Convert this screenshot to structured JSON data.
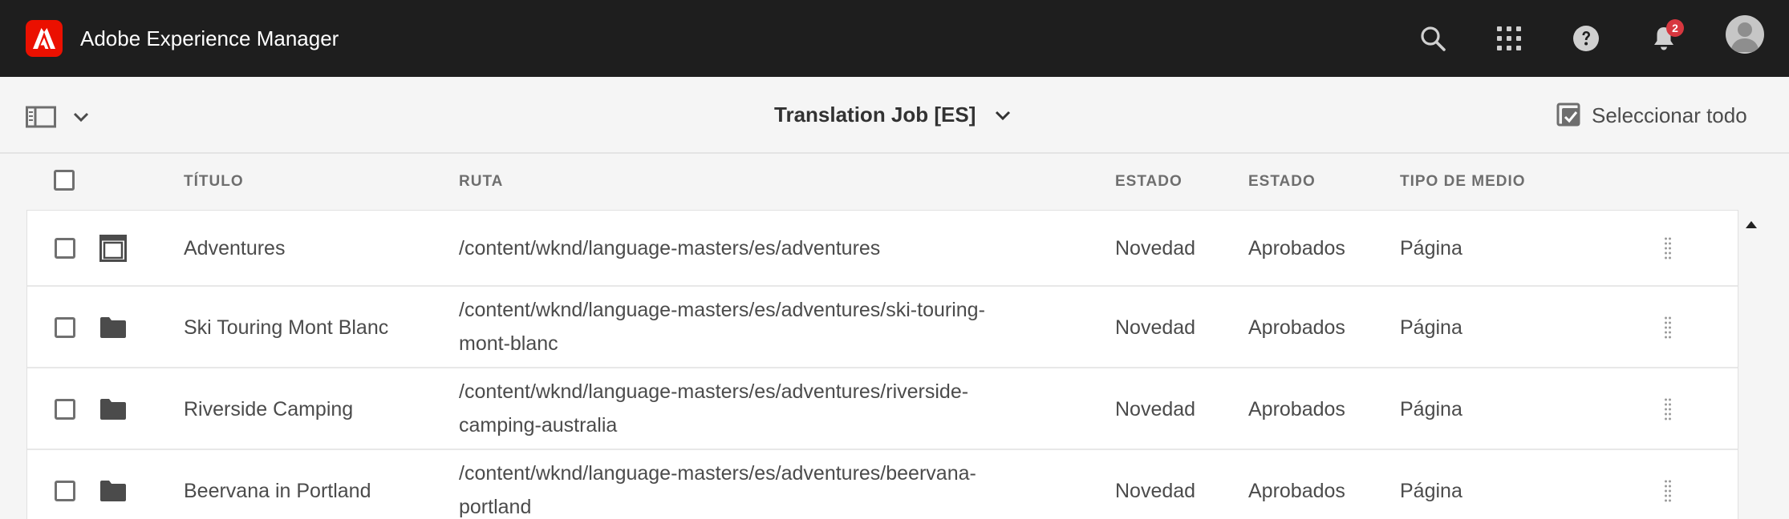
{
  "shell": {
    "app_name": "Adobe Experience Manager",
    "notification_count": "2",
    "icons": [
      "search-icon",
      "apps-grid-icon",
      "help-icon",
      "bell-icon",
      "avatar"
    ]
  },
  "actionbar": {
    "job_title": "Translation Job [ES]",
    "select_all_label": "Seleccionar todo"
  },
  "columns": {
    "title": "TÍTULO",
    "path": "RUTA",
    "status1": "ESTADO",
    "status2": "ESTADO",
    "media_type": "TIPO DE MEDIO"
  },
  "rows": [
    {
      "icon": "page-icon",
      "title": "Adventures",
      "path_line1": "/content/wknd/language-masters/es/adventures",
      "path_line2": "",
      "status1": "Novedad",
      "status2": "Aprobados",
      "media_type": "Página"
    },
    {
      "icon": "folder-icon",
      "title": "Ski Touring Mont Blanc",
      "path_line1": "/content/wknd/language-masters/es/adventures/ski-touring-",
      "path_line2": "mont-blanc",
      "status1": "Novedad",
      "status2": "Aprobados",
      "media_type": "Página"
    },
    {
      "icon": "folder-icon",
      "title": "Riverside Camping",
      "path_line1": "/content/wknd/language-masters/es/adventures/riverside-",
      "path_line2": "camping-australia",
      "status1": "Novedad",
      "status2": "Aprobados",
      "media_type": "Página"
    },
    {
      "icon": "folder-icon",
      "title": "Beervana in Portland",
      "path_line1": "/content/wknd/language-masters/es/adventures/beervana-",
      "path_line2": "portland",
      "status1": "Novedad",
      "status2": "Aprobados",
      "media_type": "Página"
    }
  ],
  "colors": {
    "shell_bg": "#1e1e1e",
    "brand_red": "#eb1000",
    "badge_red": "#d7373f",
    "page_bg": "#f5f5f5"
  }
}
